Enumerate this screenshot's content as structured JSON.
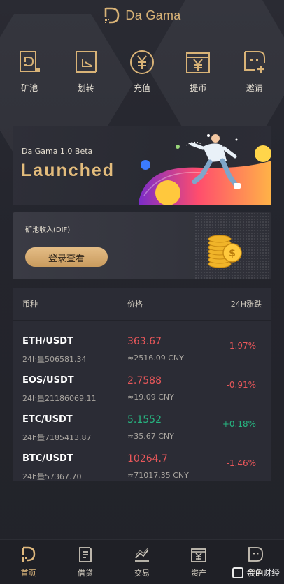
{
  "header": {
    "brand": "Da Gama"
  },
  "actions": [
    {
      "label": "矿池",
      "icon": "mining-pool-icon"
    },
    {
      "label": "划转",
      "icon": "transfer-icon"
    },
    {
      "label": "充值",
      "icon": "deposit-yen-icon"
    },
    {
      "label": "提币",
      "icon": "withdraw-yen-icon"
    },
    {
      "label": "邀请",
      "icon": "invite-icon"
    }
  ],
  "banner": {
    "subtitle": "Da Gama 1.0 Beta",
    "title": "Launched"
  },
  "earnings": {
    "label": "矿池收入(DIF)",
    "button": "登录查看"
  },
  "market": {
    "headers": {
      "pair": "币种",
      "price": "价格",
      "change": "24H涨跌"
    },
    "rows": [
      {
        "pair": "ETH/USDT",
        "volume": "24h量506581.34",
        "price": "363.67",
        "cny": "≈2516.09 CNY",
        "change": "-1.97%",
        "trend": "down"
      },
      {
        "pair": "EOS/USDT",
        "volume": "24h量21186069.11",
        "price": "2.7588",
        "cny": "≈19.09 CNY",
        "change": "-0.91%",
        "trend": "down"
      },
      {
        "pair": "ETC/USDT",
        "volume": "24h量7185413.87",
        "price": "5.1552",
        "cny": "≈35.67 CNY",
        "change": "+0.18%",
        "trend": "up"
      },
      {
        "pair": "BTC/USDT",
        "volume": "24h量57367.70",
        "price": "10264.7",
        "cny": "≈71017.35 CNY",
        "change": "-1.46%",
        "trend": "down"
      }
    ]
  },
  "tabs": [
    {
      "label": "首页",
      "icon": "home-icon",
      "active": true
    },
    {
      "label": "借贷",
      "icon": "loan-icon",
      "active": false
    },
    {
      "label": "交易",
      "icon": "trade-chart-icon",
      "active": false
    },
    {
      "label": "资产",
      "icon": "assets-icon",
      "active": false
    },
    {
      "label": "我的",
      "icon": "profile-icon",
      "active": false
    }
  ],
  "watermark": {
    "text": "金色财经"
  },
  "colors": {
    "accent": "#d9b377",
    "down": "#e8575a",
    "up": "#27b681",
    "background": "#24252d"
  }
}
